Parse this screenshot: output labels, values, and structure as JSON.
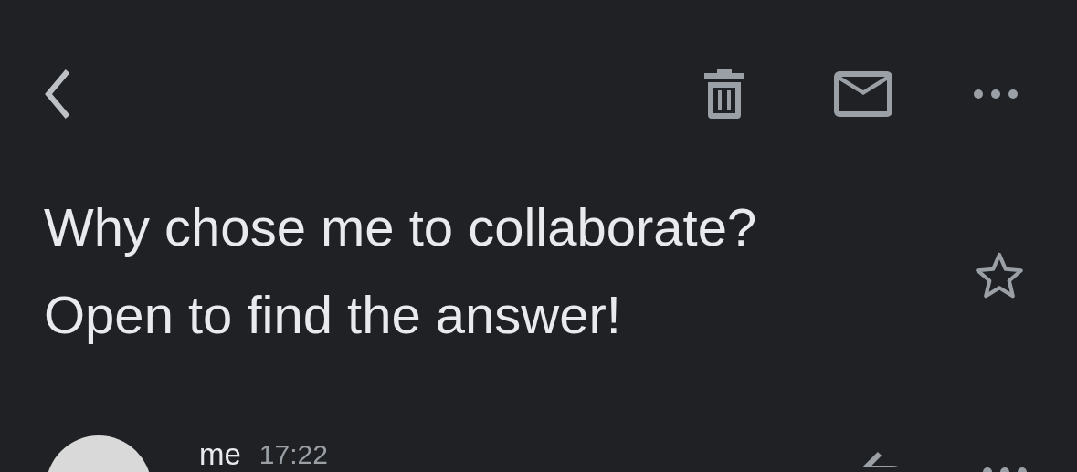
{
  "subject": {
    "text": "Why chose me to collaborate? Open to find the answer!",
    "starred": false
  },
  "message": {
    "sender": "me",
    "time": "17:22"
  }
}
